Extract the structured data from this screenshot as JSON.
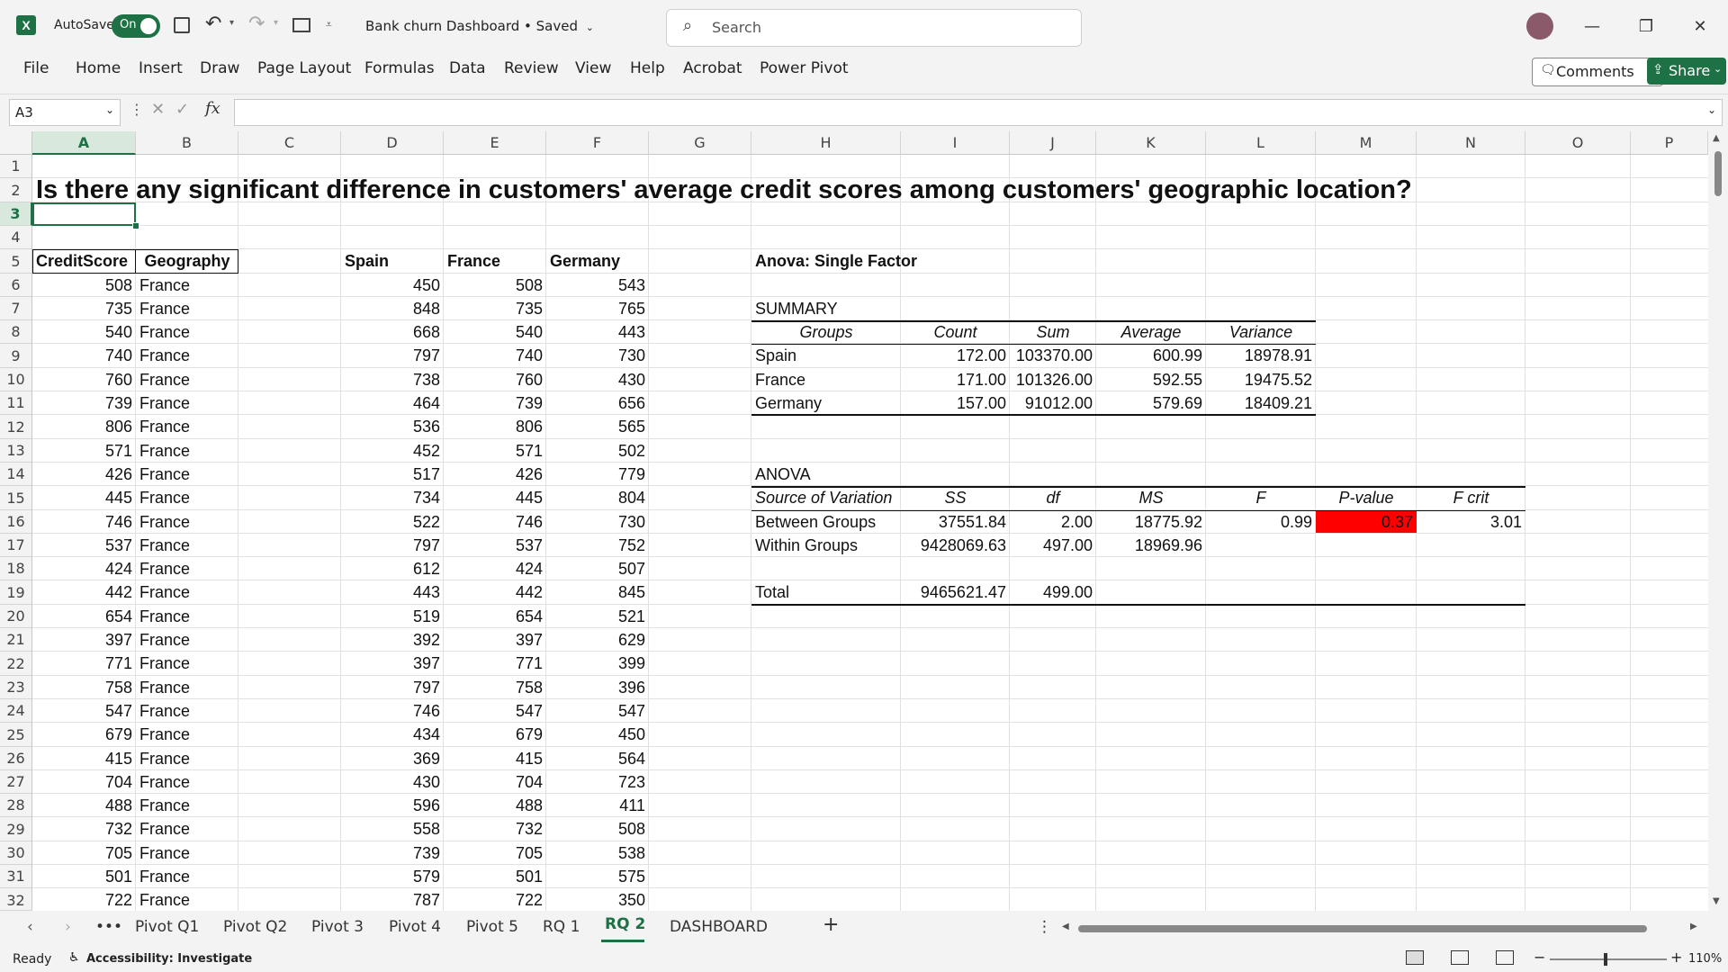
{
  "titlebar": {
    "autosave_label": "AutoSave",
    "autosave_state": "On",
    "doc_title": "Bank churn Dashboard • Saved",
    "search_placeholder": "Search"
  },
  "menu": [
    "File",
    "Home",
    "Insert",
    "Draw",
    "Page Layout",
    "Formulas",
    "Data",
    "Review",
    "View",
    "Help",
    "Acrobat",
    "Power Pivot"
  ],
  "buttons": {
    "comments": "Comments",
    "share": "Share"
  },
  "formula_bar": {
    "name_box": "A3",
    "fx": "fx",
    "content": ""
  },
  "columns": [
    "A",
    "B",
    "C",
    "D",
    "E",
    "F",
    "G",
    "H",
    "I",
    "J",
    "K",
    "L",
    "M",
    "N",
    "O",
    "P"
  ],
  "rows": [
    "1",
    "2",
    "3",
    "4",
    "5",
    "6",
    "7",
    "8",
    "9",
    "10",
    "11",
    "12",
    "13",
    "14",
    "15",
    "16",
    "17",
    "18",
    "19",
    "20",
    "21",
    "22",
    "23",
    "24",
    "25",
    "26",
    "27",
    "28",
    "29",
    "30",
    "31",
    "32"
  ],
  "sheet": {
    "question": "Is there any significant difference in customers' average credit scores among customers' geographic location?",
    "left_headers": [
      "CreditScore",
      "Geography"
    ],
    "left_rows": [
      [
        "508",
        "France"
      ],
      [
        "735",
        "France"
      ],
      [
        "540",
        "France"
      ],
      [
        "740",
        "France"
      ],
      [
        "760",
        "France"
      ],
      [
        "739",
        "France"
      ],
      [
        "806",
        "France"
      ],
      [
        "571",
        "France"
      ],
      [
        "426",
        "France"
      ],
      [
        "445",
        "France"
      ],
      [
        "746",
        "France"
      ],
      [
        "537",
        "France"
      ],
      [
        "424",
        "France"
      ],
      [
        "442",
        "France"
      ],
      [
        "654",
        "France"
      ],
      [
        "397",
        "France"
      ],
      [
        "771",
        "France"
      ],
      [
        "758",
        "France"
      ],
      [
        "547",
        "France"
      ],
      [
        "679",
        "France"
      ],
      [
        "415",
        "France"
      ],
      [
        "704",
        "France"
      ],
      [
        "488",
        "France"
      ],
      [
        "732",
        "France"
      ],
      [
        "705",
        "France"
      ],
      [
        "501",
        "France"
      ],
      [
        "722",
        "France"
      ]
    ],
    "mid_headers": [
      "Spain",
      "France",
      "Germany"
    ],
    "mid_rows": [
      [
        "450",
        "508",
        "543"
      ],
      [
        "848",
        "735",
        "765"
      ],
      [
        "668",
        "540",
        "443"
      ],
      [
        "797",
        "740",
        "730"
      ],
      [
        "738",
        "760",
        "430"
      ],
      [
        "464",
        "739",
        "656"
      ],
      [
        "536",
        "806",
        "565"
      ],
      [
        "452",
        "571",
        "502"
      ],
      [
        "517",
        "426",
        "779"
      ],
      [
        "734",
        "445",
        "804"
      ],
      [
        "522",
        "746",
        "730"
      ],
      [
        "797",
        "537",
        "752"
      ],
      [
        "612",
        "424",
        "507"
      ],
      [
        "443",
        "442",
        "845"
      ],
      [
        "519",
        "654",
        "521"
      ],
      [
        "392",
        "397",
        "629"
      ],
      [
        "397",
        "771",
        "399"
      ],
      [
        "797",
        "758",
        "396"
      ],
      [
        "746",
        "547",
        "547"
      ],
      [
        "434",
        "679",
        "450"
      ],
      [
        "369",
        "415",
        "564"
      ],
      [
        "430",
        "704",
        "723"
      ],
      [
        "596",
        "488",
        "411"
      ],
      [
        "558",
        "732",
        "508"
      ],
      [
        "739",
        "705",
        "538"
      ],
      [
        "579",
        "501",
        "575"
      ],
      [
        "787",
        "722",
        "350"
      ]
    ],
    "anova_title": "Anova: Single Factor",
    "summary_label": "SUMMARY",
    "summary_headers": [
      "Groups",
      "Count",
      "Sum",
      "Average",
      "Variance"
    ],
    "summary_rows": [
      [
        "Spain",
        "172.00",
        "103370.00",
        "600.99",
        "18978.91"
      ],
      [
        "France",
        "171.00",
        "101326.00",
        "592.55",
        "19475.52"
      ],
      [
        "Germany",
        "157.00",
        "91012.00",
        "579.69",
        "18409.21"
      ]
    ],
    "anova_label": "ANOVA",
    "anova_headers": [
      "Source of Variation",
      "SS",
      "df",
      "MS",
      "F",
      "P-value",
      "F crit"
    ],
    "anova_rows": [
      [
        "Between Groups",
        "37551.84",
        "2.00",
        "18775.92",
        "0.99",
        "0.37",
        "3.01"
      ],
      [
        "Within Groups",
        "9428069.63",
        "497.00",
        "18969.96",
        "",
        "",
        ""
      ],
      [
        "Total",
        "9465621.47",
        "499.00",
        "",
        "",
        "",
        ""
      ]
    ],
    "highlight_color": "#ff0000"
  },
  "tabs": [
    "Pivot Q1",
    "Pivot Q2",
    "Pivot 3",
    "Pivot 4",
    "Pivot 5",
    "RQ 1",
    "RQ 2",
    "DASHBOARD"
  ],
  "active_tab": "RQ 2",
  "status": {
    "ready": "Ready",
    "accessibility": "Accessibility: Investigate",
    "zoom": "110%"
  },
  "colors": {
    "accent": "#1e7145"
  }
}
